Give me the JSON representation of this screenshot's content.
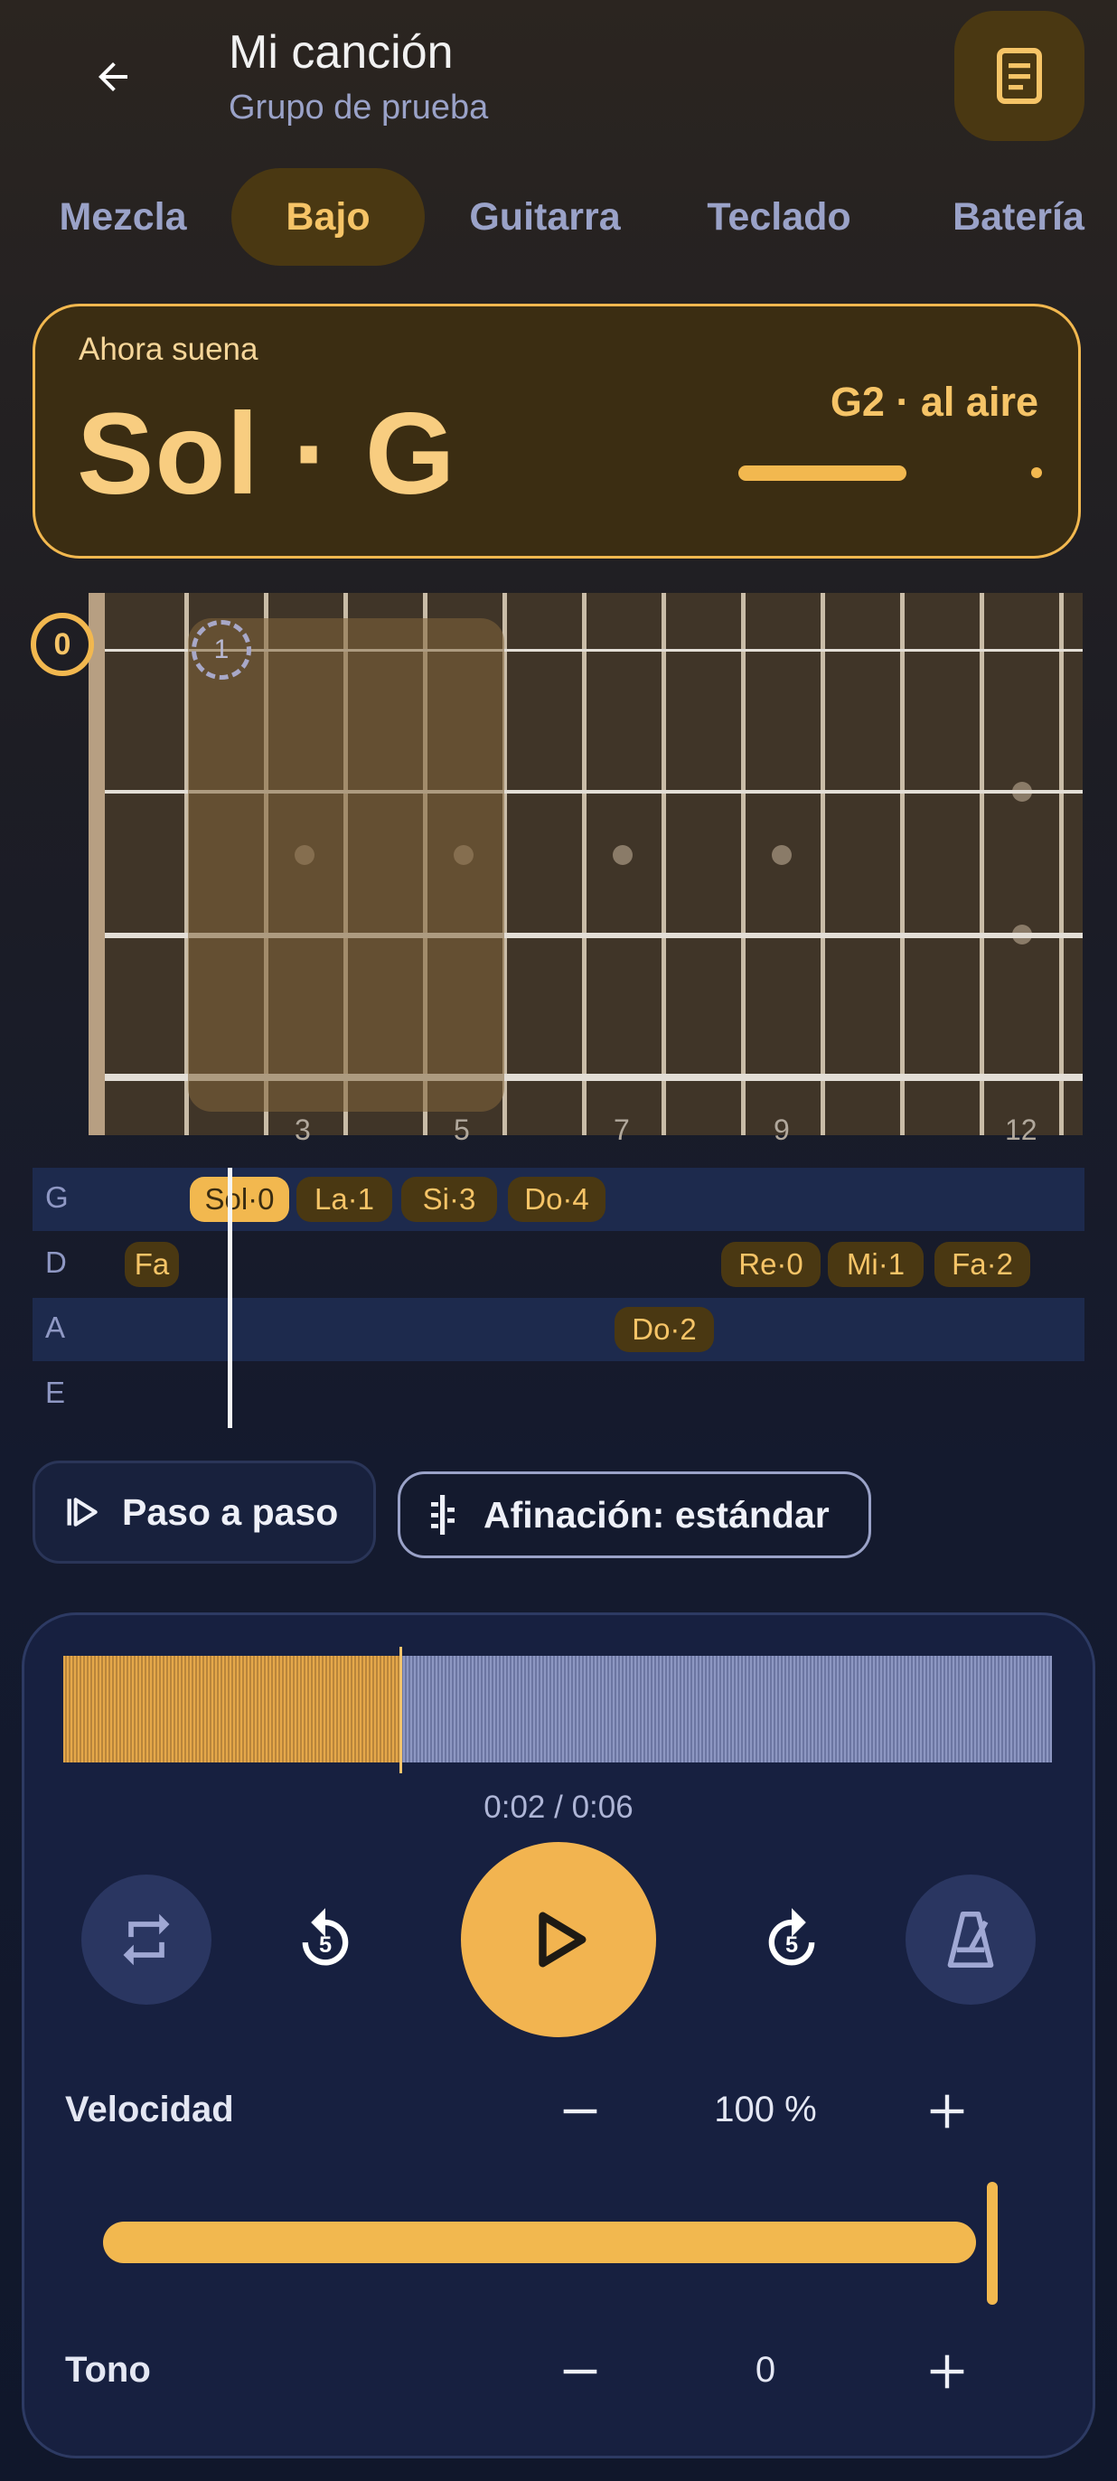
{
  "header": {
    "title": "Mi canción",
    "subtitle": "Grupo de prueba"
  },
  "tabs": [
    {
      "label": "Mezcla",
      "active": false
    },
    {
      "label": "Bajo",
      "active": true
    },
    {
      "label": "Guitarra",
      "active": false
    },
    {
      "label": "Teclado",
      "active": false
    },
    {
      "label": "Batería",
      "active": false
    }
  ],
  "now_playing": {
    "label": "Ahora suena",
    "chord": "Sol · G",
    "note": "G2 · al aire"
  },
  "fretboard": {
    "open_marker": "0",
    "ghost_marker": "1",
    "fret_numbers": [
      "3",
      "5",
      "7",
      "9",
      "12"
    ]
  },
  "tab_lanes": [
    {
      "string": "G",
      "notes": [
        "Sol·0",
        "La·1",
        "Si·3",
        "Do·4"
      ]
    },
    {
      "string": "D",
      "notes": [
        "Fa",
        "Re·0",
        "Mi·1",
        "Fa·2"
      ]
    },
    {
      "string": "A",
      "notes": [
        "Do·2"
      ]
    },
    {
      "string": "E",
      "notes": []
    }
  ],
  "actions": {
    "step_label": "Paso a paso",
    "tuning_label": "Afinación: estándar"
  },
  "player": {
    "time": "0:02 / 0:06",
    "progress": 0.34,
    "speed_label": "Velocidad",
    "speed_value": "100 %",
    "speed_fraction": 1.0,
    "pitch_label": "Tono",
    "pitch_value": "0"
  },
  "colors": {
    "accent": "#f2b84f",
    "accent_dark": "#4a3812",
    "card": "#172040"
  },
  "icons": {
    "back": "arrow-left-icon",
    "document": "document-icon",
    "step": "step-play-icon",
    "tuning": "tuning-fork-icon",
    "loop": "repeat-icon",
    "rewind": "rewind-5-icon",
    "play": "play-icon",
    "forward": "forward-5-icon",
    "metronome": "metronome-icon"
  }
}
